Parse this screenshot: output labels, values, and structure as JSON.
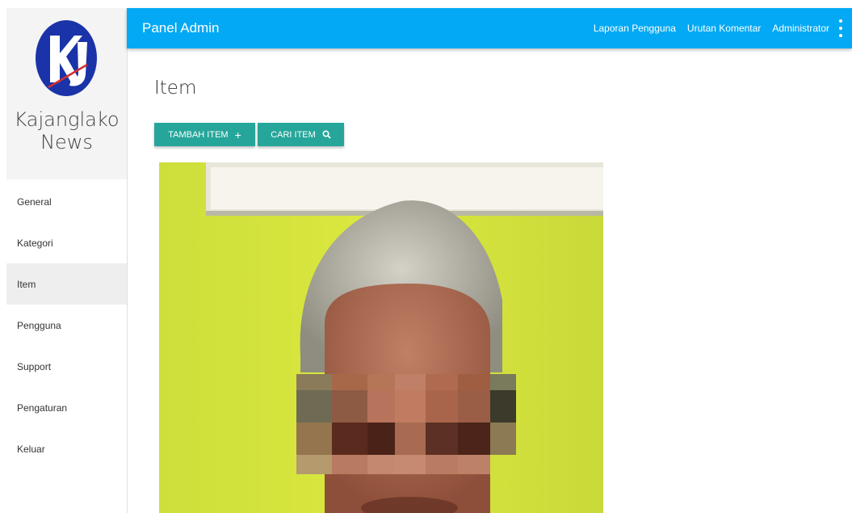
{
  "brand": {
    "name_line1": "Kajanglako",
    "name_line2": "News",
    "logo_text": "KJ"
  },
  "sidebar": {
    "items": [
      {
        "label": "General",
        "active": false
      },
      {
        "label": "Kategori",
        "active": false
      },
      {
        "label": "Item",
        "active": true
      },
      {
        "label": "Pengguna",
        "active": false
      },
      {
        "label": "Support",
        "active": false
      },
      {
        "label": "Pengaturan",
        "active": false
      },
      {
        "label": "Keluar",
        "active": false
      }
    ]
  },
  "topbar": {
    "title": "Panel Admin",
    "links": [
      "Laporan Pengguna",
      "Urutan Komentar",
      "Administrator"
    ],
    "menu_icon": "more-vert-icon"
  },
  "main": {
    "title": "Item",
    "add_button": "TAMBAH ITEM",
    "add_icon": "plus-icon",
    "search_button": "CARI ITEM",
    "search_icon": "search-icon"
  },
  "colors": {
    "topbar": "#03a9f4",
    "button": "#26a69a",
    "logo_blue": "#1a33a8",
    "logo_red": "#d32f2f",
    "sidebar_active": "#eeeeee",
    "photo_bg": "#d6e23a"
  }
}
